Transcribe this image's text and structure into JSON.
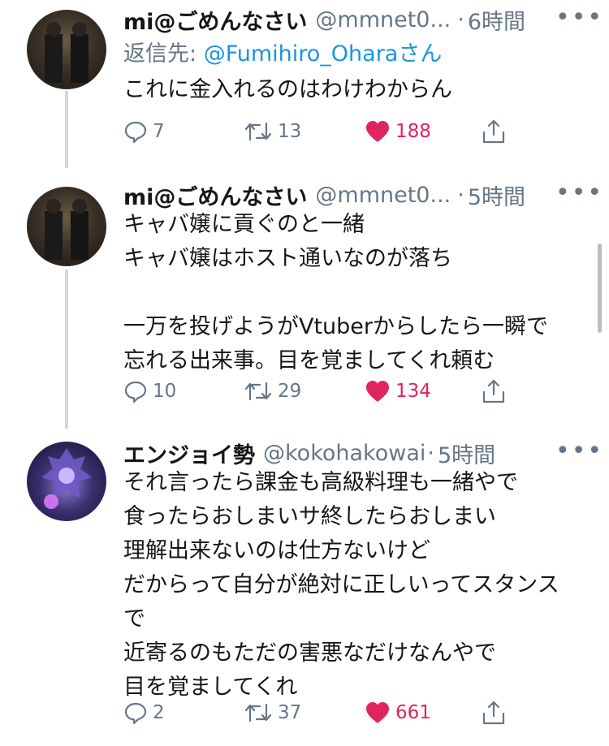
{
  "tweets": [
    {
      "name": "mi@ごめんなさい",
      "handle": "@mmnet0...",
      "separator": "·",
      "time": "6時間",
      "more": "•••",
      "reply_to_prefix": "返信先: ",
      "reply_to_user": "@Fumihiro_Ohara",
      "reply_to_suffix": "さん",
      "lines": [
        "これに金入れるのはわけわからん"
      ],
      "replies": "7",
      "retweets": "13",
      "likes": "188"
    },
    {
      "name": "mi@ごめんなさい",
      "handle": "@mmnet0...",
      "separator": "·",
      "time": "5時間",
      "more": "•••",
      "lines": [
        "キャバ嬢に貢ぐのと一緒",
        "キャバ嬢はホスト通いなのが落ち",
        "",
        "一万を投げようがVtuberからしたら一瞬で",
        "忘れる出来事。目を覚ましてくれ頼む"
      ],
      "replies": "10",
      "retweets": "29",
      "likes": "134"
    },
    {
      "name": "エンジョイ勢",
      "handle": "@kokohakowai",
      "separator": "·",
      "time": "5時間",
      "more": "•••",
      "lines": [
        "それ言ったら課金も高級料理も一緒やで",
        "食ったらおしまいサ終したらおしまい",
        "理解出来ないのは仕方ないけど",
        "だからって自分が絶対に正しいってスタンス",
        "で",
        "近寄るのもただの害悪なだけなんやで",
        "目を覚ましてくれ"
      ],
      "replies": "2",
      "retweets": "37",
      "likes": "661"
    }
  ],
  "colors": {
    "text": "#14171a",
    "secondary": "#657786",
    "link": "#1b95e0",
    "like": "#e0245e",
    "thread": "#cfd9de"
  },
  "icons": [
    "reply-icon",
    "retweet-icon",
    "heart-icon",
    "share-icon",
    "more-icon"
  ]
}
